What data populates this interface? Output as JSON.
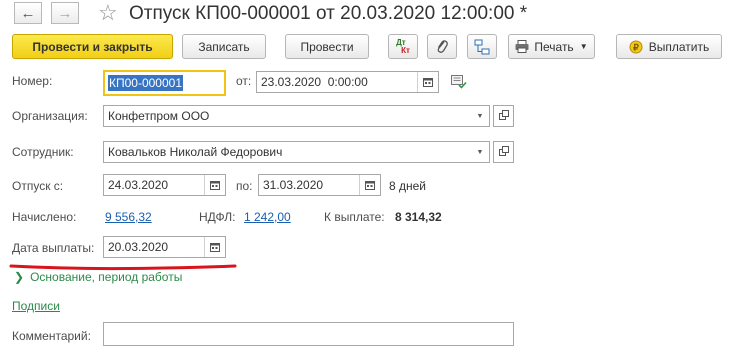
{
  "window": {
    "title": "Отпуск КП00-000001 от 20.03.2020 12:00:00 *"
  },
  "toolbar": {
    "post_close": "Провести и закрыть",
    "save": "Записать",
    "post": "Провести",
    "dt_kt_top": "Дт",
    "dt_kt_bottom": "Кт",
    "print": "Печать",
    "pay": "Выплатить"
  },
  "form": {
    "number_label": "Номер:",
    "number_value": "КП00-000001",
    "date_label": "от:",
    "date_value": "23.03.2020  0:00:00",
    "org_label": "Организация:",
    "org_value": "Конфетпром ООО",
    "employee_label": "Сотрудник:",
    "employee_value": "Ковальков Николай Федорович",
    "vacation_from_label": "Отпуск с:",
    "vacation_from_value": "24.03.2020",
    "vacation_to_label": "по:",
    "vacation_to_value": "31.03.2020",
    "days_text": "8 дней",
    "accrued_label": "Начислено:",
    "accrued_value": "9 556,32",
    "ndfl_label": "НДФЛ:",
    "ndfl_value": "1 242,00",
    "to_pay_label": "К выплате:",
    "to_pay_value": "8 314,32",
    "pay_date_label": "Дата выплаты:",
    "pay_date_value": "20.03.2020",
    "basis_section": "Основание, период работы",
    "signatures_link": "Подписи",
    "comment_label": "Комментарий:",
    "comment_value": ""
  },
  "colors": {
    "primary_button": "#f2cf16",
    "link": "#1b5fb1",
    "underline_annotation": "#d8141c",
    "section_green": "#2c8a49"
  }
}
